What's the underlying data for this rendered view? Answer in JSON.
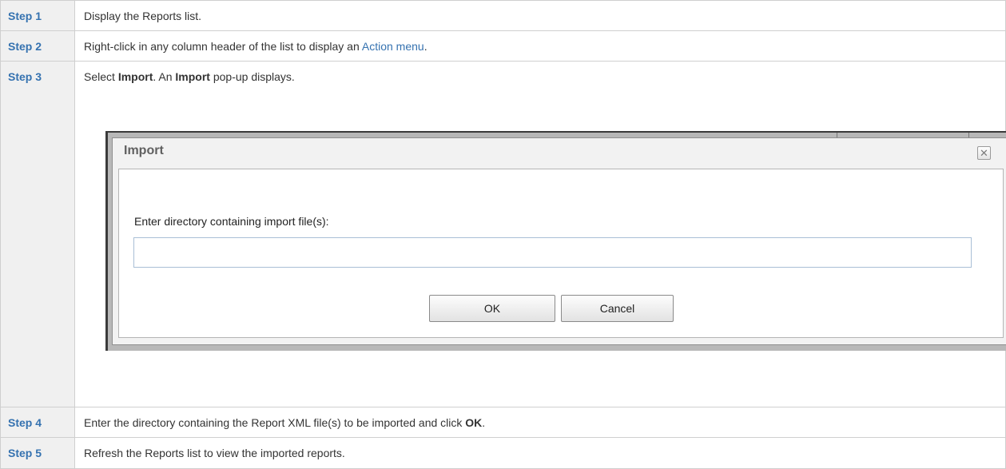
{
  "steps": [
    {
      "label": "Step 1",
      "text": "Display the Reports list."
    },
    {
      "label": "Step 2",
      "text_before": "Right-click in any column header of the list to display an ",
      "link": "Action menu",
      "text_after": "."
    },
    {
      "label": "Step 3",
      "text_1": "Select ",
      "bold_1": "Import",
      "text_2": ". An ",
      "bold_2": "Import",
      "text_3": " pop-up displays."
    },
    {
      "label": "Step 4",
      "text_before": "Enter the directory containing the Report XML file(s) to be imported and click ",
      "bold": "OK",
      "text_after": "."
    },
    {
      "label": "Step 5",
      "text": "Refresh the Reports list to view the imported reports."
    }
  ],
  "dialog": {
    "title": "Import",
    "close_icon": "close-icon",
    "field_label": "Enter directory containing import file(s):",
    "field_value": "",
    "ok_label": "OK",
    "cancel_label": "Cancel"
  },
  "colors": {
    "step_label": "#3572b0",
    "step_label_bg": "#f0f0f0",
    "link": "#3572b0"
  }
}
